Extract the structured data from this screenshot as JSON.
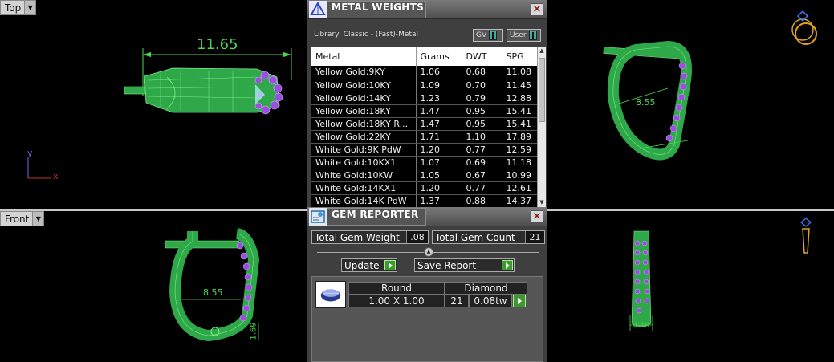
{
  "viewports": {
    "top": {
      "label": "Top"
    },
    "front": {
      "label": "Front"
    },
    "dimensions": {
      "top_width": "11.65",
      "front_inner": "8.55",
      "front_small": "1.69",
      "persp_inner": "8.55",
      "right_width": "4.10"
    },
    "axis": {
      "y": "y",
      "x": "x"
    }
  },
  "metal_weights": {
    "title": "METAL WEIGHTS",
    "library": "Library: Classic - (Fast)-Metal",
    "gv_label": "GV",
    "user_label": "User",
    "columns": [
      "Metal",
      "Grams",
      "DWT",
      "SPG"
    ],
    "rows": [
      [
        "Yellow Gold:9KY",
        "1.06",
        "0.68",
        "11.08"
      ],
      [
        "Yellow Gold:10KY",
        "1.09",
        "0.70",
        "11.45"
      ],
      [
        "Yellow Gold:14KY",
        "1.23",
        "0.79",
        "12.88"
      ],
      [
        "Yellow Gold:18KY",
        "1.47",
        "0.95",
        "15.41"
      ],
      [
        "Yellow Gold:18KY R...",
        "1.47",
        "0.95",
        "15.41"
      ],
      [
        "Yellow Gold:22KY",
        "1.71",
        "1.10",
        "17.89"
      ],
      [
        "White Gold:9K PdW",
        "1.20",
        "0.77",
        "12.59"
      ],
      [
        "White Gold:10KX1",
        "1.07",
        "0.69",
        "11.18"
      ],
      [
        "White Gold:10KW",
        "1.05",
        "0.67",
        "10.99"
      ],
      [
        "White Gold:14KX1",
        "1.20",
        "0.77",
        "12.61"
      ],
      [
        "White Gold:14K PdW",
        "1.37",
        "0.88",
        "14.37"
      ]
    ]
  },
  "gem_reporter": {
    "title": "GEM REPORTER",
    "total_weight_label": "Total Gem Weight",
    "total_weight_value": ".08",
    "total_count_label": "Total Gem Count",
    "total_count_value": "21",
    "update_label": "Update",
    "save_report_label": "Save Report",
    "gem": {
      "shape": "Round",
      "size": "1.00 X 1.00",
      "type": "Diamond",
      "count": "21",
      "tw": "0.08tw"
    }
  },
  "colors": {
    "model_green": "#2fa84a",
    "model_light_green": "#7cf08a",
    "gem_purple": "#9a4fe0",
    "dimension_green": "#4fd64f",
    "panel_bg": "#3f3f3f"
  }
}
